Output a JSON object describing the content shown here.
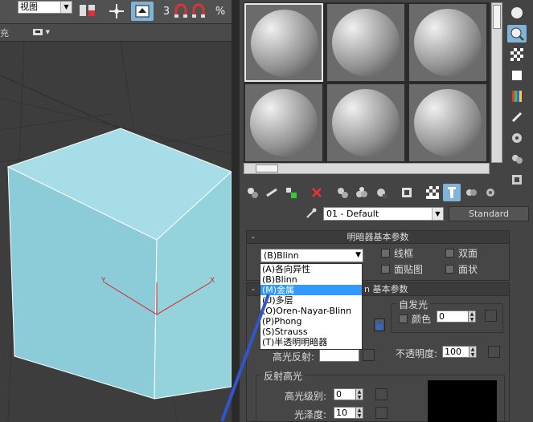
{
  "toolbar": {
    "view_select": "视图",
    "snap_number": "3",
    "percent_symbol": "%",
    "row2_label": "充"
  },
  "material": {
    "name": "01 - Default",
    "type_button": "Standard"
  },
  "shader_rollout": {
    "minus": "-",
    "title": "明暗器基本参数",
    "selected": "(B)Blinn",
    "wire": "线框",
    "two_sided": "双面",
    "face_map": "面贴图",
    "faceted": "面状",
    "options": [
      "(A)各向异性",
      "(B)Blinn",
      "(M)金属",
      "(U)多层",
      "(O)Oren-Nayar-Blinn",
      "(P)Phong",
      "(S)Strauss",
      "(T)半透明明暗器"
    ]
  },
  "basic_rollout": {
    "minus": "-",
    "title_suffix": "n 基本参数",
    "self_illum_title": "自发光",
    "color_label": "颜色",
    "color_value": "0",
    "specular_label": "高光反射:",
    "opacity_label": "不透明度:",
    "opacity_value": "100",
    "highlight_title": "反射高光",
    "spec_level_label": "高光级别:",
    "spec_level_value": "0",
    "gloss_label": "光泽度:",
    "gloss_value": "10"
  },
  "colors": {
    "cube_top": "#a6dde6",
    "cube_left": "#8ccbd8",
    "cube_right": "#94d2dc",
    "highlight": "#3399ff",
    "active_button": "#7fb3d8"
  }
}
